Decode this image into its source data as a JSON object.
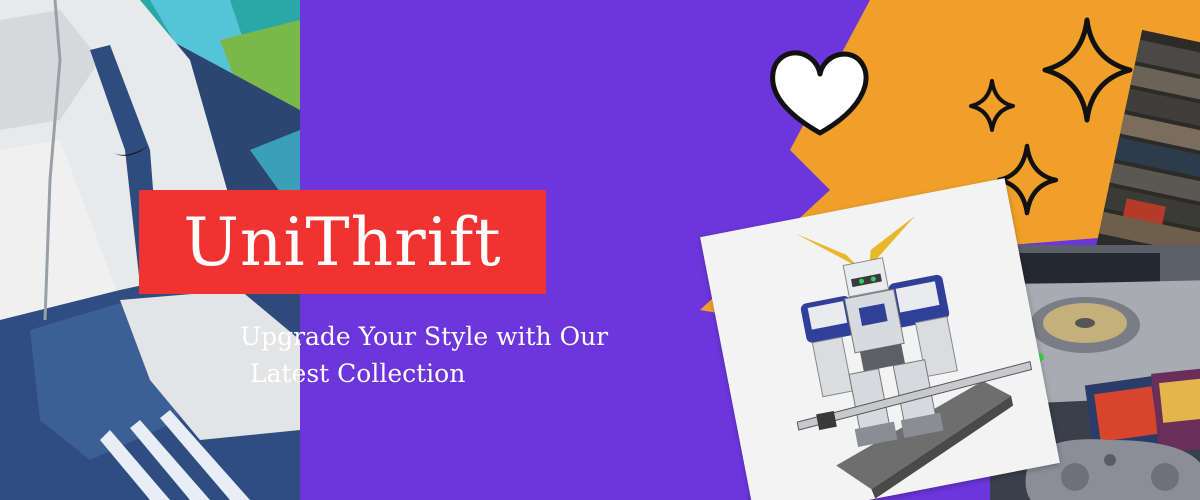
{
  "brand": {
    "name": "UniThrift",
    "tagline_line1": "Upgrade Your Style with Our",
    "tagline_line2": "Latest Collection"
  },
  "colors": {
    "background_purple": "#6c36dc",
    "accent_orange": "#f0a02a",
    "title_red": "#f03230",
    "text_white": "#ffffff"
  },
  "images": {
    "left": "vintage-windbreaker-jacket",
    "center_card": "gundam-model-figure",
    "right_bottom": "playstation-console-games",
    "right_top": "stacked-denim-jeans"
  },
  "doodles": [
    "heart-icon",
    "sparkle-icon",
    "sparkle-icon",
    "sparkle-icon"
  ]
}
